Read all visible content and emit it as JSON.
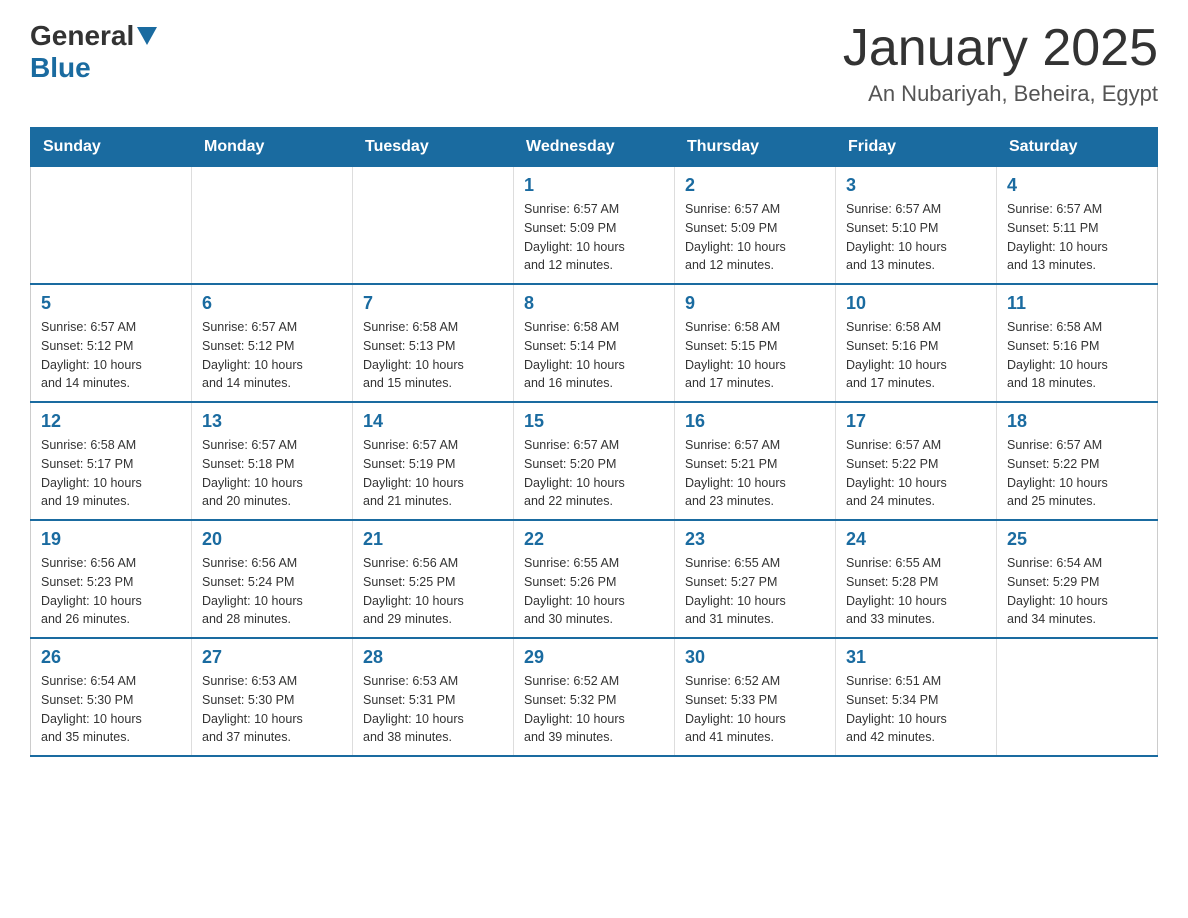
{
  "header": {
    "logo": {
      "part1": "General",
      "part2": "Blue"
    },
    "title": "January 2025",
    "location": "An Nubariyah, Beheira, Egypt"
  },
  "days_of_week": [
    "Sunday",
    "Monday",
    "Tuesday",
    "Wednesday",
    "Thursday",
    "Friday",
    "Saturday"
  ],
  "weeks": [
    [
      {
        "day": "",
        "info": ""
      },
      {
        "day": "",
        "info": ""
      },
      {
        "day": "",
        "info": ""
      },
      {
        "day": "1",
        "info": "Sunrise: 6:57 AM\nSunset: 5:09 PM\nDaylight: 10 hours\nand 12 minutes."
      },
      {
        "day": "2",
        "info": "Sunrise: 6:57 AM\nSunset: 5:09 PM\nDaylight: 10 hours\nand 12 minutes."
      },
      {
        "day": "3",
        "info": "Sunrise: 6:57 AM\nSunset: 5:10 PM\nDaylight: 10 hours\nand 13 minutes."
      },
      {
        "day": "4",
        "info": "Sunrise: 6:57 AM\nSunset: 5:11 PM\nDaylight: 10 hours\nand 13 minutes."
      }
    ],
    [
      {
        "day": "5",
        "info": "Sunrise: 6:57 AM\nSunset: 5:12 PM\nDaylight: 10 hours\nand 14 minutes."
      },
      {
        "day": "6",
        "info": "Sunrise: 6:57 AM\nSunset: 5:12 PM\nDaylight: 10 hours\nand 14 minutes."
      },
      {
        "day": "7",
        "info": "Sunrise: 6:58 AM\nSunset: 5:13 PM\nDaylight: 10 hours\nand 15 minutes."
      },
      {
        "day": "8",
        "info": "Sunrise: 6:58 AM\nSunset: 5:14 PM\nDaylight: 10 hours\nand 16 minutes."
      },
      {
        "day": "9",
        "info": "Sunrise: 6:58 AM\nSunset: 5:15 PM\nDaylight: 10 hours\nand 17 minutes."
      },
      {
        "day": "10",
        "info": "Sunrise: 6:58 AM\nSunset: 5:16 PM\nDaylight: 10 hours\nand 17 minutes."
      },
      {
        "day": "11",
        "info": "Sunrise: 6:58 AM\nSunset: 5:16 PM\nDaylight: 10 hours\nand 18 minutes."
      }
    ],
    [
      {
        "day": "12",
        "info": "Sunrise: 6:58 AM\nSunset: 5:17 PM\nDaylight: 10 hours\nand 19 minutes."
      },
      {
        "day": "13",
        "info": "Sunrise: 6:57 AM\nSunset: 5:18 PM\nDaylight: 10 hours\nand 20 minutes."
      },
      {
        "day": "14",
        "info": "Sunrise: 6:57 AM\nSunset: 5:19 PM\nDaylight: 10 hours\nand 21 minutes."
      },
      {
        "day": "15",
        "info": "Sunrise: 6:57 AM\nSunset: 5:20 PM\nDaylight: 10 hours\nand 22 minutes."
      },
      {
        "day": "16",
        "info": "Sunrise: 6:57 AM\nSunset: 5:21 PM\nDaylight: 10 hours\nand 23 minutes."
      },
      {
        "day": "17",
        "info": "Sunrise: 6:57 AM\nSunset: 5:22 PM\nDaylight: 10 hours\nand 24 minutes."
      },
      {
        "day": "18",
        "info": "Sunrise: 6:57 AM\nSunset: 5:22 PM\nDaylight: 10 hours\nand 25 minutes."
      }
    ],
    [
      {
        "day": "19",
        "info": "Sunrise: 6:56 AM\nSunset: 5:23 PM\nDaylight: 10 hours\nand 26 minutes."
      },
      {
        "day": "20",
        "info": "Sunrise: 6:56 AM\nSunset: 5:24 PM\nDaylight: 10 hours\nand 28 minutes."
      },
      {
        "day": "21",
        "info": "Sunrise: 6:56 AM\nSunset: 5:25 PM\nDaylight: 10 hours\nand 29 minutes."
      },
      {
        "day": "22",
        "info": "Sunrise: 6:55 AM\nSunset: 5:26 PM\nDaylight: 10 hours\nand 30 minutes."
      },
      {
        "day": "23",
        "info": "Sunrise: 6:55 AM\nSunset: 5:27 PM\nDaylight: 10 hours\nand 31 minutes."
      },
      {
        "day": "24",
        "info": "Sunrise: 6:55 AM\nSunset: 5:28 PM\nDaylight: 10 hours\nand 33 minutes."
      },
      {
        "day": "25",
        "info": "Sunrise: 6:54 AM\nSunset: 5:29 PM\nDaylight: 10 hours\nand 34 minutes."
      }
    ],
    [
      {
        "day": "26",
        "info": "Sunrise: 6:54 AM\nSunset: 5:30 PM\nDaylight: 10 hours\nand 35 minutes."
      },
      {
        "day": "27",
        "info": "Sunrise: 6:53 AM\nSunset: 5:30 PM\nDaylight: 10 hours\nand 37 minutes."
      },
      {
        "day": "28",
        "info": "Sunrise: 6:53 AM\nSunset: 5:31 PM\nDaylight: 10 hours\nand 38 minutes."
      },
      {
        "day": "29",
        "info": "Sunrise: 6:52 AM\nSunset: 5:32 PM\nDaylight: 10 hours\nand 39 minutes."
      },
      {
        "day": "30",
        "info": "Sunrise: 6:52 AM\nSunset: 5:33 PM\nDaylight: 10 hours\nand 41 minutes."
      },
      {
        "day": "31",
        "info": "Sunrise: 6:51 AM\nSunset: 5:34 PM\nDaylight: 10 hours\nand 42 minutes."
      },
      {
        "day": "",
        "info": ""
      }
    ]
  ]
}
